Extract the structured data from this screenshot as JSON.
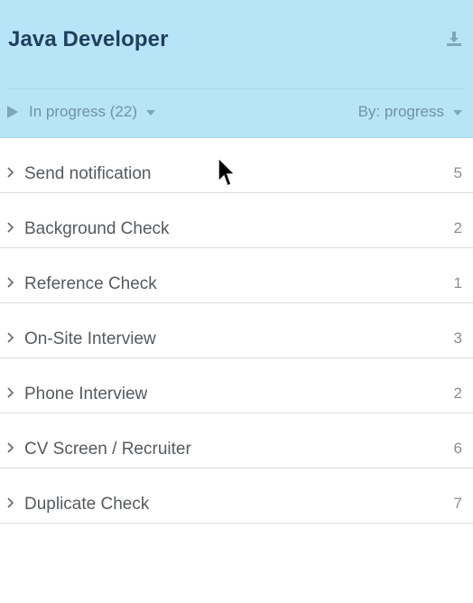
{
  "header": {
    "title": "Java Developer",
    "download_icon": "download-icon",
    "filter": {
      "icon": "play-icon",
      "label": "In progress (22)"
    },
    "sort": {
      "label": "By: progress"
    }
  },
  "stages": [
    {
      "label": "Send notification",
      "count": "5"
    },
    {
      "label": "Background Check",
      "count": "2"
    },
    {
      "label": "Reference Check",
      "count": "1"
    },
    {
      "label": "On-Site Interview",
      "count": "3"
    },
    {
      "label": "Phone Interview",
      "count": "2"
    },
    {
      "label": "CV Screen / Recruiter",
      "count": "6"
    },
    {
      "label": "Duplicate Check",
      "count": "7"
    }
  ],
  "colors": {
    "header_bg": "#b8e4f7",
    "title": "#1f3f5f",
    "muted_header_text": "#6f93a3"
  }
}
